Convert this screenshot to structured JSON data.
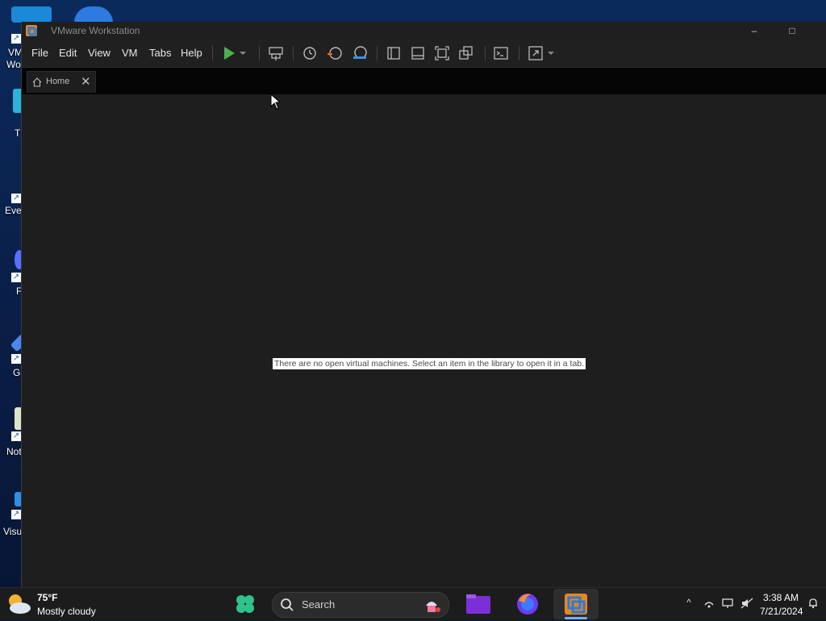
{
  "desktop": {
    "icons": [
      {
        "label": "VM",
        "label2": "Wo"
      },
      {
        "label": "T"
      },
      {
        "label": "Eve"
      },
      {
        "label": "F"
      },
      {
        "label": "G"
      },
      {
        "label": "Not"
      },
      {
        "label": "Visu"
      }
    ]
  },
  "window": {
    "title": "VMware Workstation",
    "minimize": "–",
    "maximize": "□"
  },
  "menu": {
    "items": [
      "File",
      "Edit",
      "View",
      "VM",
      "Tabs",
      "Help"
    ]
  },
  "tabs": [
    {
      "label": "Home",
      "close": "✕"
    }
  ],
  "content": {
    "message": "There are no open virtual machines. Select an item in the library to open it in a tab."
  },
  "taskbar": {
    "weather_temp": "75°F",
    "weather_condition": "Mostly cloudy",
    "search_placeholder": "Search",
    "tray_chevron": "^",
    "clock_time": "3:38 AM",
    "clock_date": "7/21/2024"
  },
  "colors": {
    "accent": "#4caf50",
    "window_bg": "#1e1e1e",
    "taskbar_active": "#6fb2ff"
  }
}
